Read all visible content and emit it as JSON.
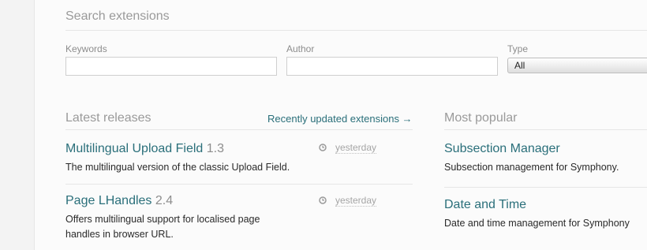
{
  "search": {
    "title": "Search extensions",
    "keywords_label": "Keywords",
    "keywords_value": "",
    "author_label": "Author",
    "author_value": "",
    "type_label": "Type",
    "type_value": "All"
  },
  "latest": {
    "title": "Latest releases",
    "link": "Recently updated extensions →",
    "items": [
      {
        "name": "Multilingual Upload Field",
        "version": "1.3",
        "date": "yesterday",
        "description": "The multilingual version of the classic Upload Field."
      },
      {
        "name": "Page LHandles",
        "version": "2.4",
        "date": "yesterday",
        "description_lines": [
          "Offers multilingual support for localised page",
          "handles in browser URL."
        ]
      }
    ]
  },
  "popular": {
    "title": "Most popular",
    "items": [
      {
        "name": "Subsection Manager",
        "description": "Subsection management for Symphony."
      },
      {
        "name": "Date and Time",
        "description": "Date and time management for Symphony"
      }
    ]
  },
  "colors": {
    "link": "#2a6f7a",
    "muted": "#9a9a9a"
  },
  "icons": {
    "date": "clock-icon"
  }
}
